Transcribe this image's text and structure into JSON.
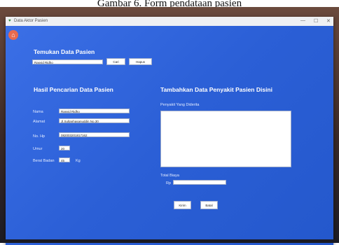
{
  "caption": "Gambar 6. Form pendataan pasien",
  "window": {
    "title": "Data Aktor Pasien",
    "minimize": "—",
    "maximize": "☐",
    "close": "✕"
  },
  "search": {
    "heading": "Temukan Data Pasien",
    "value": "Rasyid Ridho",
    "search_button": "Cari",
    "delete_button": "Hapus"
  },
  "result": {
    "heading": "Hasil Pencarian Data Pasien",
    "name_label": "Nama",
    "name_value": "Rasyid Ridho",
    "address_label": "Alamat",
    "address_value": "Jl.Sultanhasanuddin No.30",
    "phone_label": "No. Hp",
    "phone_value": "082003201817162",
    "age_label": "Umur",
    "age_value": "20",
    "weight_label": "Berat Badan",
    "weight_value": "45",
    "weight_unit": "Kg"
  },
  "disease": {
    "heading": "Tambahkan Data Penyakit Pasien Disini",
    "illness_label": "Penyakit Yang Diderita",
    "illness_value": "",
    "cost_label": "Total Biaya",
    "currency": "Rp",
    "cost_value": "",
    "submit_button": "Kirim",
    "cancel_button": "Batal"
  },
  "icons": {
    "home": "home-icon",
    "app": "app-icon"
  }
}
